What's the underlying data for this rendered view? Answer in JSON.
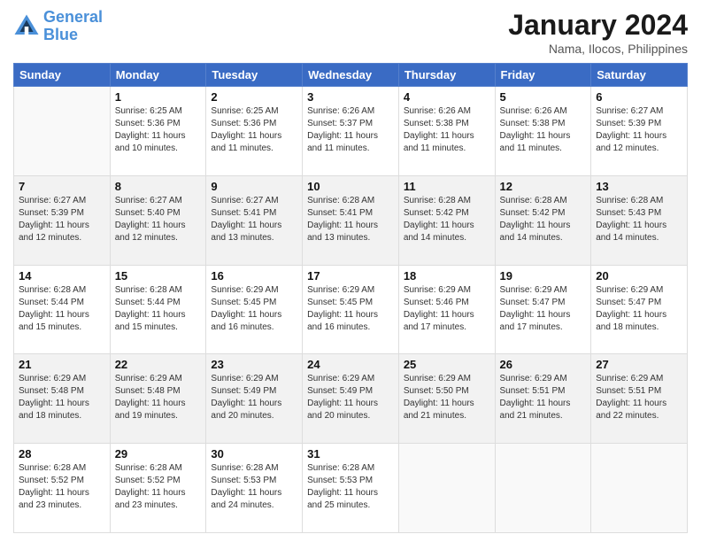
{
  "header": {
    "logo_line1": "General",
    "logo_line2": "Blue",
    "month_year": "January 2024",
    "location": "Nama, Ilocos, Philippines"
  },
  "days_of_week": [
    "Sunday",
    "Monday",
    "Tuesday",
    "Wednesday",
    "Thursday",
    "Friday",
    "Saturday"
  ],
  "weeks": [
    [
      {
        "day": "",
        "info": ""
      },
      {
        "day": "1",
        "info": "Sunrise: 6:25 AM\nSunset: 5:36 PM\nDaylight: 11 hours\nand 10 minutes."
      },
      {
        "day": "2",
        "info": "Sunrise: 6:25 AM\nSunset: 5:36 PM\nDaylight: 11 hours\nand 11 minutes."
      },
      {
        "day": "3",
        "info": "Sunrise: 6:26 AM\nSunset: 5:37 PM\nDaylight: 11 hours\nand 11 minutes."
      },
      {
        "day": "4",
        "info": "Sunrise: 6:26 AM\nSunset: 5:38 PM\nDaylight: 11 hours\nand 11 minutes."
      },
      {
        "day": "5",
        "info": "Sunrise: 6:26 AM\nSunset: 5:38 PM\nDaylight: 11 hours\nand 11 minutes."
      },
      {
        "day": "6",
        "info": "Sunrise: 6:27 AM\nSunset: 5:39 PM\nDaylight: 11 hours\nand 12 minutes."
      }
    ],
    [
      {
        "day": "7",
        "info": "Sunrise: 6:27 AM\nSunset: 5:39 PM\nDaylight: 11 hours\nand 12 minutes."
      },
      {
        "day": "8",
        "info": "Sunrise: 6:27 AM\nSunset: 5:40 PM\nDaylight: 11 hours\nand 12 minutes."
      },
      {
        "day": "9",
        "info": "Sunrise: 6:27 AM\nSunset: 5:41 PM\nDaylight: 11 hours\nand 13 minutes."
      },
      {
        "day": "10",
        "info": "Sunrise: 6:28 AM\nSunset: 5:41 PM\nDaylight: 11 hours\nand 13 minutes."
      },
      {
        "day": "11",
        "info": "Sunrise: 6:28 AM\nSunset: 5:42 PM\nDaylight: 11 hours\nand 14 minutes."
      },
      {
        "day": "12",
        "info": "Sunrise: 6:28 AM\nSunset: 5:42 PM\nDaylight: 11 hours\nand 14 minutes."
      },
      {
        "day": "13",
        "info": "Sunrise: 6:28 AM\nSunset: 5:43 PM\nDaylight: 11 hours\nand 14 minutes."
      }
    ],
    [
      {
        "day": "14",
        "info": "Sunrise: 6:28 AM\nSunset: 5:44 PM\nDaylight: 11 hours\nand 15 minutes."
      },
      {
        "day": "15",
        "info": "Sunrise: 6:28 AM\nSunset: 5:44 PM\nDaylight: 11 hours\nand 15 minutes."
      },
      {
        "day": "16",
        "info": "Sunrise: 6:29 AM\nSunset: 5:45 PM\nDaylight: 11 hours\nand 16 minutes."
      },
      {
        "day": "17",
        "info": "Sunrise: 6:29 AM\nSunset: 5:45 PM\nDaylight: 11 hours\nand 16 minutes."
      },
      {
        "day": "18",
        "info": "Sunrise: 6:29 AM\nSunset: 5:46 PM\nDaylight: 11 hours\nand 17 minutes."
      },
      {
        "day": "19",
        "info": "Sunrise: 6:29 AM\nSunset: 5:47 PM\nDaylight: 11 hours\nand 17 minutes."
      },
      {
        "day": "20",
        "info": "Sunrise: 6:29 AM\nSunset: 5:47 PM\nDaylight: 11 hours\nand 18 minutes."
      }
    ],
    [
      {
        "day": "21",
        "info": "Sunrise: 6:29 AM\nSunset: 5:48 PM\nDaylight: 11 hours\nand 18 minutes."
      },
      {
        "day": "22",
        "info": "Sunrise: 6:29 AM\nSunset: 5:48 PM\nDaylight: 11 hours\nand 19 minutes."
      },
      {
        "day": "23",
        "info": "Sunrise: 6:29 AM\nSunset: 5:49 PM\nDaylight: 11 hours\nand 20 minutes."
      },
      {
        "day": "24",
        "info": "Sunrise: 6:29 AM\nSunset: 5:49 PM\nDaylight: 11 hours\nand 20 minutes."
      },
      {
        "day": "25",
        "info": "Sunrise: 6:29 AM\nSunset: 5:50 PM\nDaylight: 11 hours\nand 21 minutes."
      },
      {
        "day": "26",
        "info": "Sunrise: 6:29 AM\nSunset: 5:51 PM\nDaylight: 11 hours\nand 21 minutes."
      },
      {
        "day": "27",
        "info": "Sunrise: 6:29 AM\nSunset: 5:51 PM\nDaylight: 11 hours\nand 22 minutes."
      }
    ],
    [
      {
        "day": "28",
        "info": "Sunrise: 6:28 AM\nSunset: 5:52 PM\nDaylight: 11 hours\nand 23 minutes."
      },
      {
        "day": "29",
        "info": "Sunrise: 6:28 AM\nSunset: 5:52 PM\nDaylight: 11 hours\nand 23 minutes."
      },
      {
        "day": "30",
        "info": "Sunrise: 6:28 AM\nSunset: 5:53 PM\nDaylight: 11 hours\nand 24 minutes."
      },
      {
        "day": "31",
        "info": "Sunrise: 6:28 AM\nSunset: 5:53 PM\nDaylight: 11 hours\nand 25 minutes."
      },
      {
        "day": "",
        "info": ""
      },
      {
        "day": "",
        "info": ""
      },
      {
        "day": "",
        "info": ""
      }
    ]
  ]
}
